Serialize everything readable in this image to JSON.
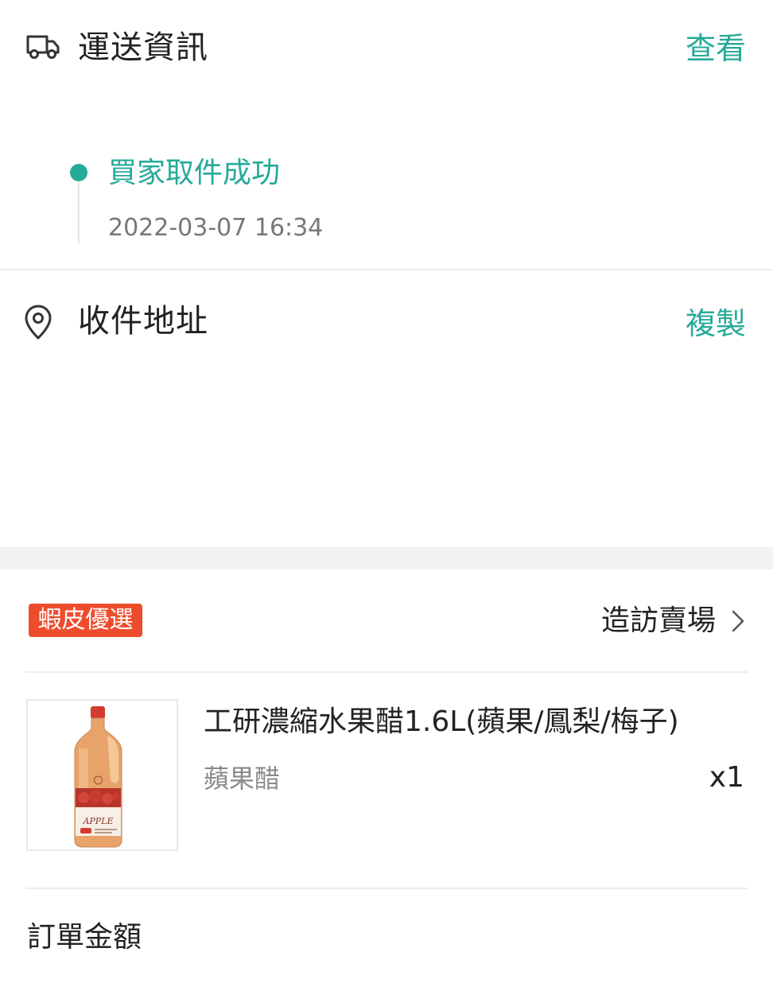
{
  "shipping": {
    "title": "運送資訊",
    "action": "查看",
    "status": "買家取件成功",
    "timestamp": "2022-03-07 16:34",
    "icon": "truck-icon"
  },
  "address": {
    "title": "收件地址",
    "action": "複製",
    "icon": "location-pin-icon"
  },
  "shop": {
    "badge": "蝦皮優選",
    "visit_label": "造訪賣場",
    "chevron_icon": "chevron-right-icon"
  },
  "product": {
    "name": "工研濃縮水果醋1.6L(蘋果/鳳梨/梅子)",
    "variant": "蘋果醋",
    "quantity": "x1",
    "image_label": "APPLE",
    "image_icon": "vinegar-bottle-image"
  },
  "order": {
    "total_label": "訂單金額"
  },
  "colors": {
    "accent": "#26aa99",
    "badge": "#ee4d2d",
    "text": "#222222",
    "muted": "#777777"
  }
}
